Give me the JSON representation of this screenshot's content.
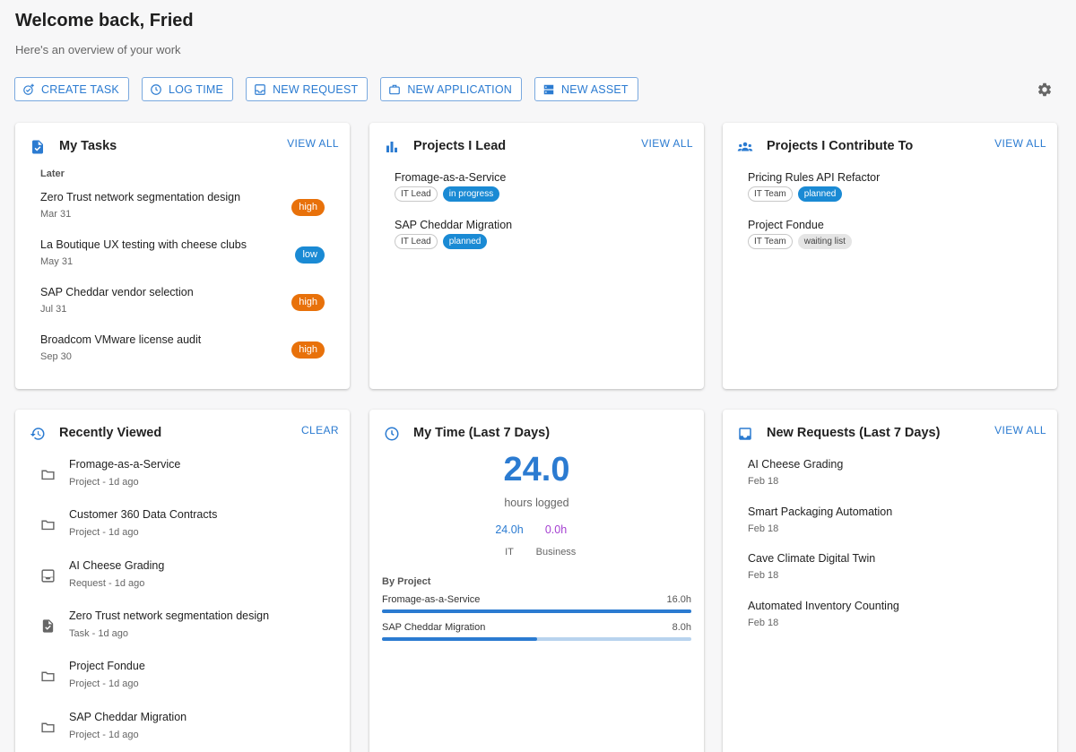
{
  "header": {
    "title": "Welcome back, Fried",
    "subtitle": "Here's an overview of your work"
  },
  "actions": {
    "create_task": "CREATE TASK",
    "log_time": "LOG TIME",
    "new_request": "NEW REQUEST",
    "new_application": "NEW APPLICATION",
    "new_asset": "NEW ASSET",
    "settings_icon": "gear-icon"
  },
  "my_tasks": {
    "title": "My Tasks",
    "link": "VIEW ALL",
    "group": "Later",
    "items": [
      {
        "name": "Zero Trust network segmentation design",
        "date": "Mar 31",
        "priority": "high"
      },
      {
        "name": "La Boutique UX testing with cheese clubs",
        "date": "May 31",
        "priority": "low"
      },
      {
        "name": "SAP Cheddar vendor selection",
        "date": "Jul 31",
        "priority": "high"
      },
      {
        "name": "Broadcom VMware license audit",
        "date": "Sep 30",
        "priority": "high"
      }
    ]
  },
  "projects_lead": {
    "title": "Projects I Lead",
    "link": "VIEW ALL",
    "items": [
      {
        "name": "Fromage-as-a-Service",
        "role": "IT Lead",
        "status": "in progress"
      },
      {
        "name": "SAP Cheddar Migration",
        "role": "IT Lead",
        "status": "planned"
      }
    ]
  },
  "projects_contrib": {
    "title": "Projects I Contribute To",
    "link": "VIEW ALL",
    "items": [
      {
        "name": "Pricing Rules API Refactor",
        "role": "IT Team",
        "status": "planned"
      },
      {
        "name": "Project Fondue",
        "role": "IT Team",
        "status": "waiting list"
      }
    ]
  },
  "recently_viewed": {
    "title": "Recently Viewed",
    "link": "CLEAR",
    "items": [
      {
        "name": "Fromage-as-a-Service",
        "meta": "Project - 1d ago",
        "icon": "folder-icon"
      },
      {
        "name": "Customer 360 Data Contracts",
        "meta": "Project - 1d ago",
        "icon": "folder-icon"
      },
      {
        "name": "AI Cheese Grading",
        "meta": "Request - 1d ago",
        "icon": "inbox-icon"
      },
      {
        "name": "Zero Trust network segmentation design",
        "meta": "Task - 1d ago",
        "icon": "task-icon"
      },
      {
        "name": "Project Fondue",
        "meta": "Project - 1d ago",
        "icon": "folder-icon"
      },
      {
        "name": "SAP Cheddar Migration",
        "meta": "Project - 1d ago",
        "icon": "folder-icon"
      }
    ]
  },
  "my_time": {
    "title": "My Time (Last 7 Days)",
    "total": "24.0",
    "total_label": "hours logged",
    "it_value": "24.0h",
    "it_label": "IT",
    "business_value": "0.0h",
    "business_label": "Business",
    "by_project_label": "By Project",
    "projects": [
      {
        "name": "Fromage-as-a-Service",
        "hours": "16.0h",
        "fraction": 1.0
      },
      {
        "name": "SAP Cheddar Migration",
        "hours": "8.0h",
        "fraction": 0.5
      }
    ]
  },
  "new_requests": {
    "title": "New Requests (Last 7 Days)",
    "link": "VIEW ALL",
    "items": [
      {
        "name": "AI Cheese Grading",
        "date": "Feb 18"
      },
      {
        "name": "Smart Packaging Automation",
        "date": "Feb 18"
      },
      {
        "name": "Cave Climate Digital Twin",
        "date": "Feb 18"
      },
      {
        "name": "Automated Inventory Counting",
        "date": "Feb 18"
      }
    ]
  },
  "colors": {
    "accent": "#2b7bd1",
    "high": "#e8710a",
    "low": "#1a8ad4",
    "business": "#a43fd1"
  }
}
